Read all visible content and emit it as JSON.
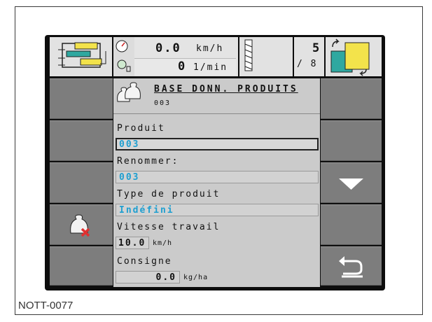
{
  "caption": "NOTT-0077",
  "topbar": {
    "speed_value": "0.0",
    "speed_unit": "km/h",
    "rpm_value": "0",
    "rpm_unit": "1/min",
    "section_active": "5",
    "section_total": "/ 8"
  },
  "header": {
    "title": "BASE DONN. PRODUITS",
    "subtitle": "003"
  },
  "form": {
    "produit_label": "Produit",
    "produit_value": "003",
    "renommer_label": "Renommer:",
    "renommer_value": "003",
    "type_label": "Type de produit",
    "type_value": "Indéfini",
    "vitesse_label": "Vitesse travail",
    "vitesse_value": "10.0",
    "vitesse_unit": "km/h",
    "consigne_label": "Consigne",
    "consigne_value": "0.0",
    "consigne_unit": "kg/ha"
  },
  "colors": {
    "value_blue": "#1f9fd0",
    "delete_red": "#e03030",
    "soft_key_grey": "#7d7d7d"
  },
  "icons": {
    "left_top": "tank-layout-icon",
    "right_top": "section-overview-icon",
    "speed": "speedometer-icon",
    "rpm": "pto-icon",
    "tyre": "tyre-track-icon",
    "product": "product-bags-icon",
    "delete": "delete-product-icon",
    "down": "arrow-down-icon",
    "back": "back-arrow-icon"
  }
}
